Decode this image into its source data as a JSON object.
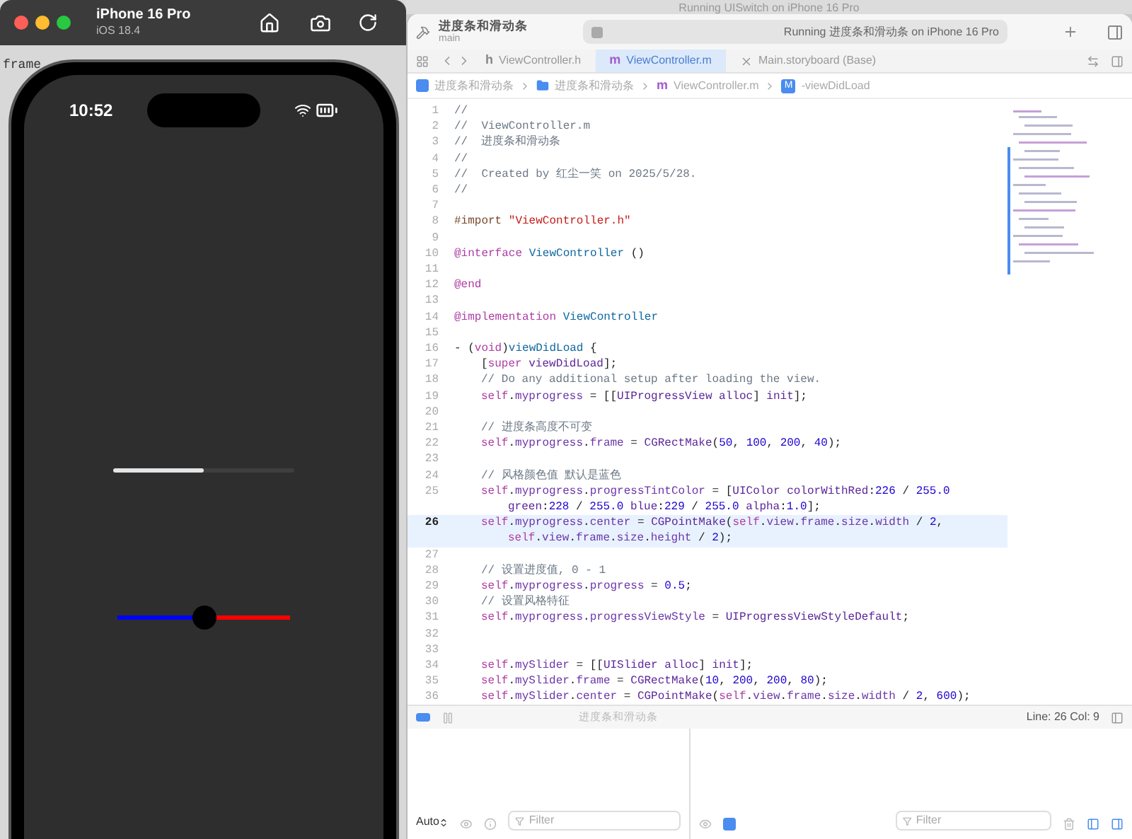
{
  "background_text": "frame",
  "simulator": {
    "device": "iPhone 16 Pro",
    "os": "iOS 18.4",
    "time": "10:52",
    "progress": {
      "level": 0.5
    },
    "slider": {
      "level": 0.5
    }
  },
  "behind_window": {
    "title": "Running UISwitch on iPhone 16 Pro"
  },
  "xcode": {
    "project": "进度条和滑动条",
    "branch": "main",
    "activity": "Running 进度条和滑动条 on iPhone 16 Pro",
    "tabs": [
      {
        "label": "ViewController.h",
        "kind": "h",
        "icon": "h",
        "selected": false
      },
      {
        "label": "ViewController.m",
        "kind": "m",
        "icon": "m",
        "selected": true
      },
      {
        "label": "Main.storyboard (Base)",
        "kind": "storyboard",
        "selected": false
      }
    ],
    "breadcrumbs": [
      {
        "label": "进度条和滑动条",
        "kind": "project"
      },
      {
        "label": "进度条和滑动条",
        "kind": "folder"
      },
      {
        "label": "ViewController.m",
        "kind": "m",
        "icon": "m"
      },
      {
        "label": "-viewDidLoad",
        "kind": "method",
        "icon": "M"
      }
    ],
    "code": [
      {
        "number": "1",
        "current": false,
        "indented": false,
        "tokens": [
          {
            "kind": "c",
            "text": "//"
          }
        ]
      },
      {
        "number": "2",
        "current": false,
        "indented": false,
        "tokens": [
          {
            "kind": "c",
            "text": "//  ViewController.m"
          }
        ]
      },
      {
        "number": "3",
        "current": false,
        "indented": false,
        "tokens": [
          {
            "kind": "c",
            "text": "//  进度条和滑动条"
          }
        ]
      },
      {
        "number": "4",
        "current": false,
        "indented": false,
        "tokens": [
          {
            "kind": "c",
            "text": "//"
          }
        ]
      },
      {
        "number": "5",
        "current": false,
        "indented": false,
        "tokens": [
          {
            "kind": "c",
            "text": "//  Created by 红尘一笑 on 2025/5/28."
          }
        ]
      },
      {
        "number": "6",
        "current": false,
        "indented": false,
        "tokens": [
          {
            "kind": "c",
            "text": "//"
          }
        ]
      },
      {
        "number": "7",
        "current": false
      },
      {
        "number": "8",
        "current": false,
        "indented": false,
        "tokens": [
          {
            "kind": "p",
            "text": "#import "
          },
          {
            "kind": "s",
            "text": "\"ViewController.h\""
          }
        ]
      },
      {
        "number": "9",
        "current": false
      },
      {
        "number": "10",
        "current": false,
        "indented": false,
        "tokens": [
          {
            "kind": "k",
            "text": "@interface "
          },
          {
            "kind": "d",
            "text": "ViewController"
          },
          {
            "kind": "x",
            "text": " ()"
          }
        ]
      },
      {
        "number": "11",
        "current": false
      },
      {
        "number": "12",
        "current": false,
        "indented": false,
        "tokens": [
          {
            "kind": "k",
            "text": "@end"
          }
        ]
      },
      {
        "number": "13",
        "current": false
      },
      {
        "number": "14",
        "current": false,
        "indented": false,
        "tokens": [
          {
            "kind": "k",
            "text": "@implementation "
          },
          {
            "kind": "d",
            "text": "ViewController"
          }
        ]
      },
      {
        "number": "15",
        "current": false
      },
      {
        "number": "16",
        "current": false,
        "indented": false,
        "tokens": [
          {
            "kind": "x",
            "text": "- ("
          },
          {
            "kind": "k",
            "text": "void"
          },
          {
            "kind": "x",
            "text": ")"
          },
          {
            "kind": "d",
            "text": "viewDidLoad"
          },
          {
            "kind": "x",
            "text": " {"
          }
        ]
      },
      {
        "number": "17",
        "current": false,
        "indented": true,
        "tokens": [
          {
            "kind": "x",
            "text": "["
          },
          {
            "kind": "k",
            "text": "super "
          },
          {
            "kind": "t",
            "text": "viewDidLoad"
          },
          {
            "kind": "x",
            "text": "];"
          }
        ]
      },
      {
        "number": "18",
        "current": false,
        "indented": true,
        "tokens": [
          {
            "kind": "c",
            "text": "// Do any additional setup after loading the view."
          }
        ]
      },
      {
        "number": "19",
        "current": false,
        "indented": true,
        "tokens": [
          {
            "kind": "k",
            "text": "self"
          },
          {
            "kind": "x",
            "text": "."
          },
          {
            "kind": "m",
            "text": "myprogress"
          },
          {
            "kind": "x",
            "text": " = [["
          },
          {
            "kind": "t",
            "text": "UIProgressView alloc"
          },
          {
            "kind": "x",
            "text": "] "
          },
          {
            "kind": "t",
            "text": "init"
          },
          {
            "kind": "x",
            "text": "];"
          }
        ]
      },
      {
        "number": "20",
        "current": false
      },
      {
        "number": "21",
        "current": false,
        "indented": true,
        "tokens": [
          {
            "kind": "c",
            "text": "// 进度条高度不可变"
          }
        ]
      },
      {
        "number": "22",
        "current": false,
        "indented": true,
        "tokens": [
          {
            "kind": "k",
            "text": "self"
          },
          {
            "kind": "x",
            "text": "."
          },
          {
            "kind": "m",
            "text": "myprogress"
          },
          {
            "kind": "x",
            "text": "."
          },
          {
            "kind": "m",
            "text": "frame"
          },
          {
            "kind": "x",
            "text": " = "
          },
          {
            "kind": "t",
            "text": "CGRectMake"
          },
          {
            "kind": "x",
            "text": "("
          },
          {
            "kind": "n",
            "text": "50"
          },
          {
            "kind": "x",
            "text": ", "
          },
          {
            "kind": "n",
            "text": "100"
          },
          {
            "kind": "x",
            "text": ", "
          },
          {
            "kind": "n",
            "text": "200"
          },
          {
            "kind": "x",
            "text": ", "
          },
          {
            "kind": "n",
            "text": "40"
          },
          {
            "kind": "x",
            "text": ");"
          }
        ]
      },
      {
        "number": "23",
        "current": false
      },
      {
        "number": "24",
        "current": false,
        "indented": true,
        "tokens": [
          {
            "kind": "c",
            "text": "// 风格颜色值 默认是蓝色"
          }
        ]
      },
      {
        "number": "25",
        "current": false,
        "indented": true,
        "tokens": [
          {
            "kind": "k",
            "text": "self"
          },
          {
            "kind": "x",
            "text": "."
          },
          {
            "kind": "m",
            "text": "myprogress"
          },
          {
            "kind": "x",
            "text": "."
          },
          {
            "kind": "m",
            "text": "progressTintColor"
          },
          {
            "kind": "x",
            "text": " = ["
          },
          {
            "kind": "t",
            "text": "UIColor colorWithRed"
          },
          {
            "kind": "x",
            "text": ":"
          },
          {
            "kind": "n",
            "text": "226"
          },
          {
            "kind": "x",
            "text": " / "
          },
          {
            "kind": "n",
            "text": "255.0"
          }
        ],
        "wrapped_tokens": [
          {
            "kind": "t",
            "text": "green"
          },
          {
            "kind": "x",
            "text": ":"
          },
          {
            "kind": "n",
            "text": "228"
          },
          {
            "kind": "x",
            "text": " / "
          },
          {
            "kind": "n",
            "text": "255.0 "
          },
          {
            "kind": "t",
            "text": "blue"
          },
          {
            "kind": "x",
            "text": ":"
          },
          {
            "kind": "n",
            "text": "229"
          },
          {
            "kind": "x",
            "text": " / "
          },
          {
            "kind": "n",
            "text": "255.0 "
          },
          {
            "kind": "t",
            "text": "alpha"
          },
          {
            "kind": "x",
            "text": ":"
          },
          {
            "kind": "n",
            "text": "1.0"
          },
          {
            "kind": "x",
            "text": "];"
          }
        ]
      },
      {
        "number": "26",
        "current": true,
        "indented": true,
        "tokens": [
          {
            "kind": "k",
            "text": "self"
          },
          {
            "kind": "x",
            "text": "."
          },
          {
            "kind": "m",
            "text": "myprogress"
          },
          {
            "kind": "x",
            "text": "."
          },
          {
            "kind": "m",
            "text": "center"
          },
          {
            "kind": "x",
            "text": " = "
          },
          {
            "kind": "t",
            "text": "CGPointMake"
          },
          {
            "kind": "x",
            "text": "("
          },
          {
            "kind": "k",
            "text": "self"
          },
          {
            "kind": "x",
            "text": "."
          },
          {
            "kind": "m",
            "text": "view"
          },
          {
            "kind": "x",
            "text": "."
          },
          {
            "kind": "m",
            "text": "frame"
          },
          {
            "kind": "x",
            "text": "."
          },
          {
            "kind": "m",
            "text": "size"
          },
          {
            "kind": "x",
            "text": "."
          },
          {
            "kind": "m",
            "text": "width"
          },
          {
            "kind": "x",
            "text": " / "
          },
          {
            "kind": "n",
            "text": "2"
          },
          {
            "kind": "x",
            "text": ","
          }
        ],
        "wrapped_tokens": [
          {
            "kind": "k",
            "text": "self"
          },
          {
            "kind": "x",
            "text": "."
          },
          {
            "kind": "m",
            "text": "view"
          },
          {
            "kind": "x",
            "text": "."
          },
          {
            "kind": "m",
            "text": "frame"
          },
          {
            "kind": "x",
            "text": "."
          },
          {
            "kind": "m",
            "text": "size"
          },
          {
            "kind": "x",
            "text": "."
          },
          {
            "kind": "m",
            "text": "height"
          },
          {
            "kind": "x",
            "text": " / "
          },
          {
            "kind": "n",
            "text": "2"
          },
          {
            "kind": "x",
            "text": ");"
          }
        ]
      },
      {
        "number": "27",
        "current": false
      },
      {
        "number": "28",
        "current": false,
        "indented": true,
        "tokens": [
          {
            "kind": "c",
            "text": "// 设置进度值, 0 - 1"
          }
        ]
      },
      {
        "number": "29",
        "current": false,
        "indented": true,
        "tokens": [
          {
            "kind": "k",
            "text": "self"
          },
          {
            "kind": "x",
            "text": "."
          },
          {
            "kind": "m",
            "text": "myprogress"
          },
          {
            "kind": "x",
            "text": "."
          },
          {
            "kind": "m",
            "text": "progress"
          },
          {
            "kind": "x",
            "text": " = "
          },
          {
            "kind": "n",
            "text": "0.5"
          },
          {
            "kind": "x",
            "text": ";"
          }
        ]
      },
      {
        "number": "30",
        "current": false,
        "indented": true,
        "tokens": [
          {
            "kind": "c",
            "text": "// 设置风格特征"
          }
        ]
      },
      {
        "number": "31",
        "current": false,
        "indented": true,
        "tokens": [
          {
            "kind": "k",
            "text": "self"
          },
          {
            "kind": "x",
            "text": "."
          },
          {
            "kind": "m",
            "text": "myprogress"
          },
          {
            "kind": "x",
            "text": "."
          },
          {
            "kind": "m",
            "text": "progressViewStyle"
          },
          {
            "kind": "x",
            "text": " = "
          },
          {
            "kind": "t",
            "text": "UIProgressViewStyleDefault"
          },
          {
            "kind": "x",
            "text": ";"
          }
        ]
      },
      {
        "number": "32",
        "current": false
      },
      {
        "number": "33",
        "current": false
      },
      {
        "number": "34",
        "current": false,
        "indented": true,
        "tokens": [
          {
            "kind": "k",
            "text": "self"
          },
          {
            "kind": "x",
            "text": "."
          },
          {
            "kind": "m",
            "text": "mySlider"
          },
          {
            "kind": "x",
            "text": " = [["
          },
          {
            "kind": "t",
            "text": "UISlider alloc"
          },
          {
            "kind": "x",
            "text": "] "
          },
          {
            "kind": "t",
            "text": "init"
          },
          {
            "kind": "x",
            "text": "];"
          }
        ]
      },
      {
        "number": "35",
        "current": false,
        "indented": true,
        "tokens": [
          {
            "kind": "k",
            "text": "self"
          },
          {
            "kind": "x",
            "text": "."
          },
          {
            "kind": "m",
            "text": "mySlider"
          },
          {
            "kind": "x",
            "text": "."
          },
          {
            "kind": "m",
            "text": "frame"
          },
          {
            "kind": "x",
            "text": " = "
          },
          {
            "kind": "t",
            "text": "CGRectMake"
          },
          {
            "kind": "x",
            "text": "("
          },
          {
            "kind": "n",
            "text": "10"
          },
          {
            "kind": "x",
            "text": ", "
          },
          {
            "kind": "n",
            "text": "200"
          },
          {
            "kind": "x",
            "text": ", "
          },
          {
            "kind": "n",
            "text": "200"
          },
          {
            "kind": "x",
            "text": ", "
          },
          {
            "kind": "n",
            "text": "80"
          },
          {
            "kind": "x",
            "text": ");"
          }
        ]
      },
      {
        "number": "36",
        "current": false,
        "indented": true,
        "tokens": [
          {
            "kind": "k",
            "text": "self"
          },
          {
            "kind": "x",
            "text": "."
          },
          {
            "kind": "m",
            "text": "mySlider"
          },
          {
            "kind": "x",
            "text": "."
          },
          {
            "kind": "m",
            "text": "center"
          },
          {
            "kind": "x",
            "text": " = "
          },
          {
            "kind": "t",
            "text": "CGPointMake"
          },
          {
            "kind": "x",
            "text": "("
          },
          {
            "kind": "k",
            "text": "self"
          },
          {
            "kind": "x",
            "text": "."
          },
          {
            "kind": "m",
            "text": "view"
          },
          {
            "kind": "x",
            "text": "."
          },
          {
            "kind": "m",
            "text": "frame"
          },
          {
            "kind": "x",
            "text": "."
          },
          {
            "kind": "m",
            "text": "size"
          },
          {
            "kind": "x",
            "text": "."
          },
          {
            "kind": "m",
            "text": "width"
          },
          {
            "kind": "x",
            "text": " / "
          },
          {
            "kind": "n",
            "text": "2"
          },
          {
            "kind": "x",
            "text": ", "
          },
          {
            "kind": "n",
            "text": "600"
          },
          {
            "kind": "x",
            "text": ");"
          }
        ]
      }
    ],
    "debug_bar": {
      "target": "进度条和滑动条",
      "position": "Line: 26 Col: 9"
    },
    "variables": {
      "scope": "Auto",
      "filter_placeholder": "Filter"
    },
    "console": {
      "filter_placeholder": "Filter"
    }
  }
}
